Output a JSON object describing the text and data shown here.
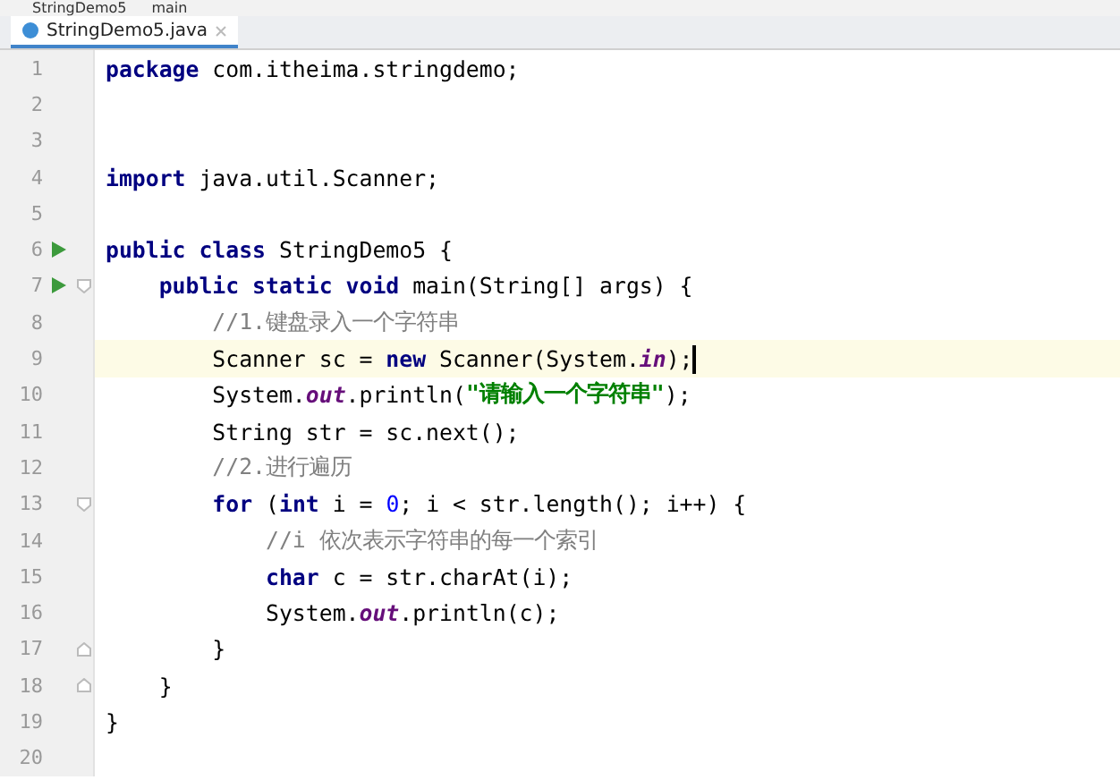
{
  "breadcrumbs": [
    "StringDemo5",
    "main"
  ],
  "tabs": [
    {
      "label": "StringDemo5.java",
      "selected": true
    }
  ],
  "lines": [
    {
      "number": "1",
      "run": false,
      "fold_open": false,
      "fold_close": false,
      "current": false,
      "tokens": [
        {
          "kind": "kw",
          "text": "package"
        },
        {
          "kind": "plain",
          "text": " com.itheima.stringdemo;"
        }
      ]
    },
    {
      "number": "2",
      "run": false,
      "fold_open": false,
      "fold_close": false,
      "current": false
    },
    {
      "number": "3",
      "run": false,
      "fold_open": false,
      "fold_close": false,
      "current": false
    },
    {
      "number": "4",
      "run": false,
      "fold_open": false,
      "fold_close": false,
      "current": false,
      "tokens": [
        {
          "kind": "kw",
          "text": "import"
        },
        {
          "kind": "plain",
          "text": " java.util.Scanner;"
        }
      ]
    },
    {
      "number": "5",
      "run": false,
      "fold_open": false,
      "fold_close": false,
      "current": false
    },
    {
      "number": "6",
      "run": true,
      "fold_open": false,
      "fold_close": false,
      "current": false,
      "tokens": [
        {
          "kind": "kw",
          "text": "public class"
        },
        {
          "kind": "plain",
          "text": " StringDemo5 {"
        }
      ]
    },
    {
      "number": "7",
      "run": true,
      "fold_open": true,
      "fold_close": false,
      "current": false,
      "tokens": [
        {
          "kind": "kw",
          "text": "    public static void"
        },
        {
          "kind": "plain",
          "text": " main(String[] args) {"
        }
      ]
    },
    {
      "number": "8",
      "run": false,
      "fold_open": false,
      "fold_close": false,
      "current": false,
      "tokens": [
        {
          "kind": "comment",
          "text": "        //1.键盘录入一个字符串"
        }
      ]
    },
    {
      "number": "9",
      "run": false,
      "fold_open": false,
      "fold_close": false,
      "current": true,
      "tokens": [
        {
          "kind": "plain",
          "text": "        Scanner sc = "
        },
        {
          "kind": "kw",
          "text": "new"
        },
        {
          "kind": "plain",
          "text": " Scanner(System."
        },
        {
          "kind": "static",
          "text": "in"
        },
        {
          "kind": "plain",
          "text": ");"
        }
      ]
    },
    {
      "number": "10",
      "run": false,
      "fold_open": false,
      "fold_close": false,
      "current": false,
      "tokens": [
        {
          "kind": "plain",
          "text": "        System."
        },
        {
          "kind": "static",
          "text": "out"
        },
        {
          "kind": "plain",
          "text": ".println("
        },
        {
          "kind": "string",
          "text": "\"请输入一个字符串\""
        },
        {
          "kind": "plain",
          "text": ");"
        }
      ]
    },
    {
      "number": "11",
      "run": false,
      "fold_open": false,
      "fold_close": false,
      "current": false,
      "tokens": [
        {
          "kind": "plain",
          "text": "        String str = sc.next();"
        }
      ]
    },
    {
      "number": "12",
      "run": false,
      "fold_open": false,
      "fold_close": false,
      "current": false,
      "tokens": [
        {
          "kind": "comment",
          "text": "        //2.进行遍历"
        }
      ]
    },
    {
      "number": "13",
      "run": false,
      "fold_open": true,
      "fold_close": false,
      "current": false,
      "tokens": [
        {
          "kind": "kw",
          "text": "        for"
        },
        {
          "kind": "plain",
          "text": " ("
        },
        {
          "kind": "kw",
          "text": "int"
        },
        {
          "kind": "plain",
          "text": " i = "
        },
        {
          "kind": "num",
          "text": "0"
        },
        {
          "kind": "plain",
          "text": "; i < str.length(); i++) {"
        }
      ]
    },
    {
      "number": "14",
      "run": false,
      "fold_open": false,
      "fold_close": false,
      "current": false,
      "tokens": [
        {
          "kind": "comment",
          "text": "            //i 依次表示字符串的每一个索引"
        }
      ]
    },
    {
      "number": "15",
      "run": false,
      "fold_open": false,
      "fold_close": false,
      "current": false,
      "tokens": [
        {
          "kind": "kw",
          "text": "            char"
        },
        {
          "kind": "plain",
          "text": " c = str.charAt(i);"
        }
      ]
    },
    {
      "number": "16",
      "run": false,
      "fold_open": false,
      "fold_close": false,
      "current": false,
      "tokens": [
        {
          "kind": "plain",
          "text": "            System."
        },
        {
          "kind": "static",
          "text": "out"
        },
        {
          "kind": "plain",
          "text": ".println(c);"
        }
      ]
    },
    {
      "number": "17",
      "run": false,
      "fold_open": false,
      "fold_close": true,
      "current": false,
      "tokens": [
        {
          "kind": "plain",
          "text": "        }"
        }
      ]
    },
    {
      "number": "18",
      "run": false,
      "fold_open": false,
      "fold_close": true,
      "current": false,
      "tokens": [
        {
          "kind": "plain",
          "text": "    }"
        }
      ]
    },
    {
      "number": "19",
      "run": false,
      "fold_open": false,
      "fold_close": false,
      "current": false,
      "tokens": [
        {
          "kind": "plain",
          "text": "}"
        }
      ]
    },
    {
      "number": "20",
      "run": false,
      "fold_open": false,
      "fold_close": false,
      "current": false
    }
  ]
}
